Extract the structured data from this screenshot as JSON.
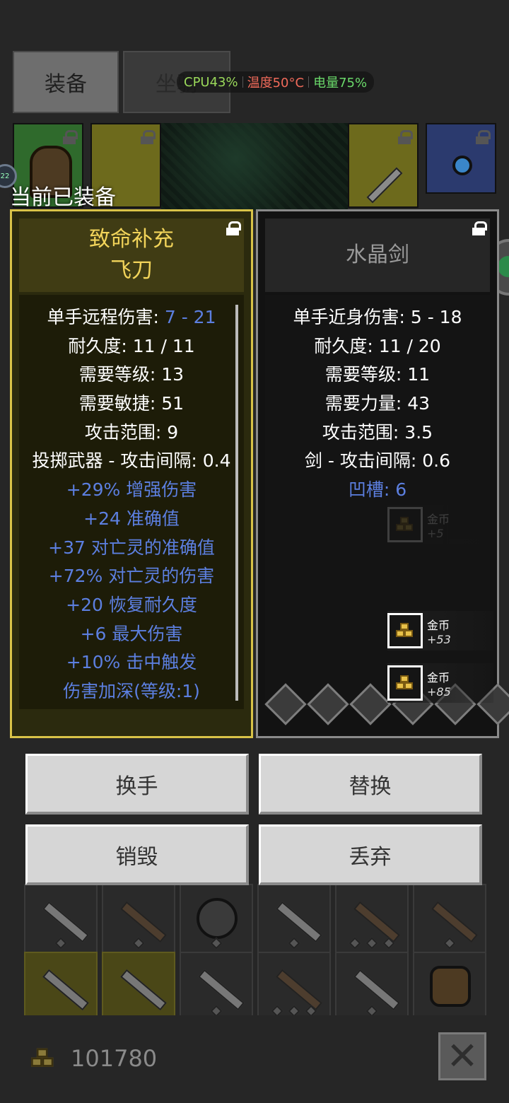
{
  "tabs": [
    {
      "label": "装备"
    },
    {
      "label": "坐骑"
    }
  ],
  "hud": {
    "cpu": "CPU43%",
    "temp": "温度50°C",
    "battery": "电量75%",
    "colors": {
      "cpu": "#9ad95a",
      "temp": "#f06a5a",
      "battery": "#6ad96a"
    }
  },
  "equipped_label": "当前已装备",
  "badge": "22",
  "left_item": {
    "name_line1": "致命补充",
    "name_line2": "飞刀",
    "stats": [
      {
        "prefix": "单手远程伤害: ",
        "value": "7 - 21"
      },
      {
        "text": "耐久度: 11 / 11"
      },
      {
        "text": "需要等级: 13"
      },
      {
        "text": "需要敏捷: 51"
      },
      {
        "text": "攻击范围: 9"
      },
      {
        "text": "投掷武器 - 攻击间隔: 0.4"
      }
    ],
    "bonuses": [
      "+29% 增强伤害",
      "+24 准确值",
      "+37 对亡灵的准确值",
      "+72% 对亡灵的伤害",
      "+20 恢复耐久度",
      "+6 最大伤害",
      "+10% 击中触发",
      "伤害加深(等级:1)"
    ]
  },
  "right_item": {
    "name": "水晶剑",
    "stats": [
      "单手近身伤害: 5 - 18",
      "耐久度: 11 / 20",
      "需要等级: 11",
      "需要力量: 43",
      "攻击范围: 3.5",
      "剑 - 攻击间隔: 0.6"
    ],
    "sockets": "凹槽: 6",
    "socket_count": 6
  },
  "toasts": [
    {
      "title": "金币",
      "amount": "+5",
      "faded": true
    },
    {
      "title": "金币",
      "amount": "+53",
      "faded": false
    },
    {
      "title": "金币",
      "amount": "+85",
      "faded": false
    }
  ],
  "buttons": {
    "swap_hand": "换手",
    "replace": "替换",
    "destroy": "销毁",
    "drop": "丢弃"
  },
  "gold": {
    "amount": "101780"
  },
  "colors": {
    "rare_gold": "#f2d45a",
    "magic_blue": "#5c7fe0"
  }
}
